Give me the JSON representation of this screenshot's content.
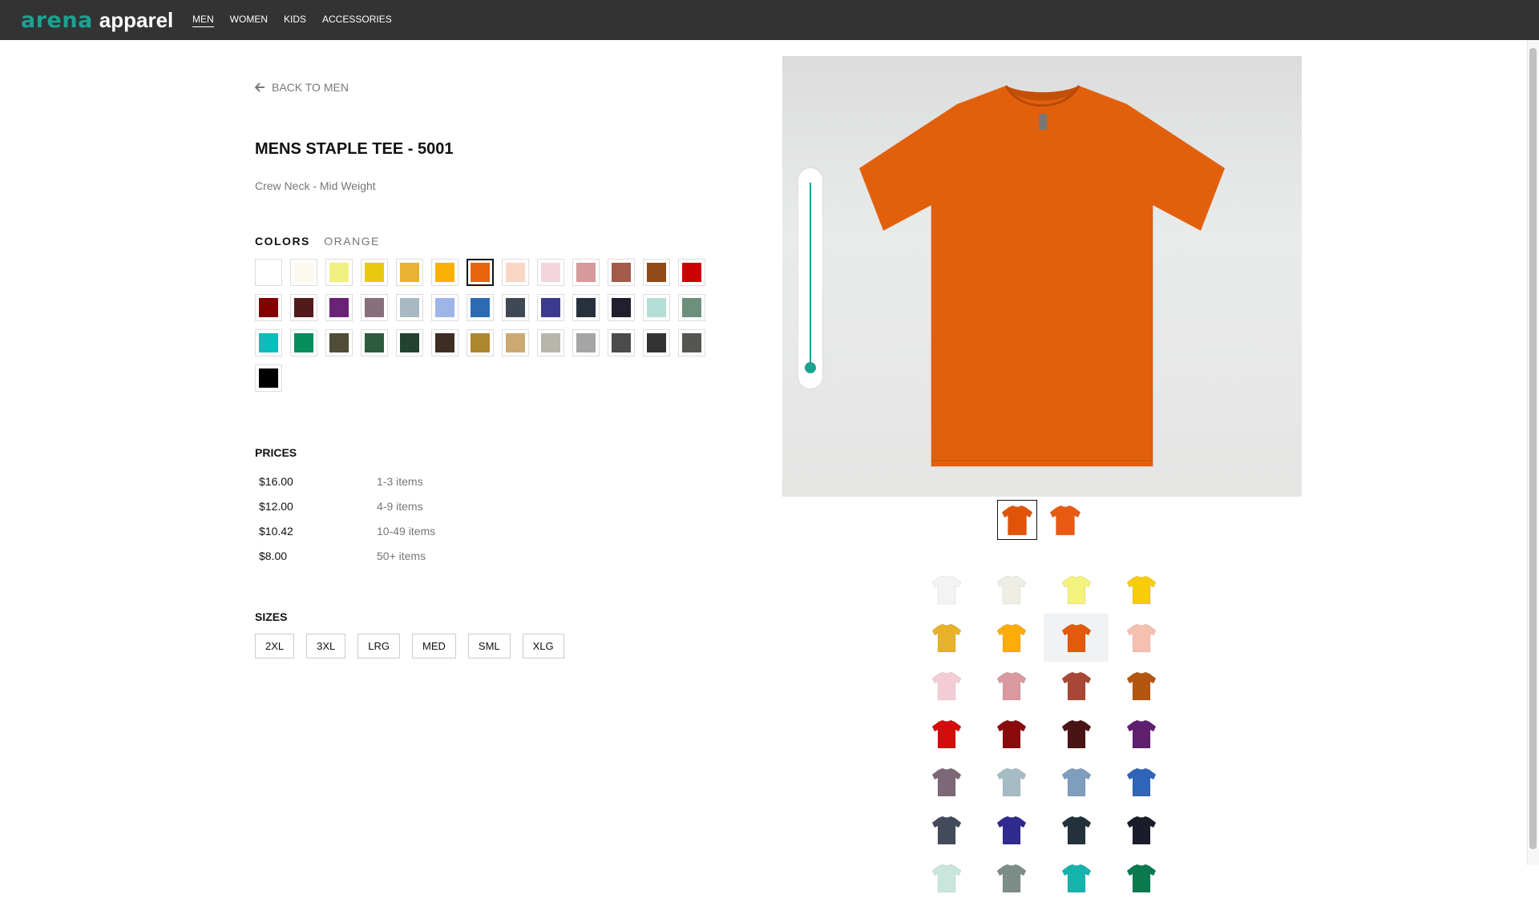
{
  "brand": {
    "logo_arena": "arena",
    "logo_apparel": "apparel"
  },
  "nav": {
    "items": [
      "MEN",
      "WOMEN",
      "KIDS",
      "ACCESSORIES"
    ],
    "active": "MEN"
  },
  "back_link": {
    "label": "BACK TO MEN"
  },
  "product": {
    "title": "MENS STAPLE TEE - 5001",
    "subtitle": "Crew Neck - Mid Weight",
    "main_color": "#e2600c"
  },
  "colors": {
    "label": "COLORS",
    "selected_name": "ORANGE",
    "swatches": [
      "#ffffff",
      "#fbf8ee",
      "#f2f07e",
      "#e8c90e",
      "#e8b330",
      "#fbb103",
      "#e8640c",
      "#f9d6c4",
      "#f3d5db",
      "#d59a99",
      "#a35a4b",
      "#924a19",
      "#cc0202",
      "#840000",
      "#521b1a",
      "#6b2378",
      "#87707b",
      "#a9b9c1",
      "#9db5e7",
      "#2c6bb3",
      "#414855",
      "#3b3a90",
      "#26313b",
      "#211e2e",
      "#b5dfd6",
      "#6d907c",
      "#0abcbc",
      "#068d5b",
      "#4f4d35",
      "#2d5b3d",
      "#234231",
      "#3f2c22",
      "#ae8630",
      "#cca872",
      "#b8b6ab",
      "#a5a5a5",
      "#4b4b4b",
      "#333333",
      "#555652",
      "#000000"
    ],
    "selected_index": 6
  },
  "prices": {
    "label": "PRICES",
    "rows": [
      {
        "price": "$16.00",
        "qty": "1-3 items"
      },
      {
        "price": "$12.00",
        "qty": "4-9 items"
      },
      {
        "price": "$10.42",
        "qty": "10-49 items"
      },
      {
        "price": "$8.00",
        "qty": "50+ items"
      }
    ]
  },
  "sizes": {
    "label": "SIZES",
    "items": [
      "2XL",
      "3XL",
      "LRG",
      "MED",
      "SML",
      "XLG"
    ]
  },
  "zoom_level": 0,
  "thumbnails": {
    "colors": [
      "#e0540a",
      "#e85a12"
    ],
    "active": 0
  },
  "color_grid": {
    "colors": [
      "#f3f3f3",
      "#efeee4",
      "#f2f27c",
      "#f7cc0c",
      "#e7b22a",
      "#fdac0a",
      "#e25a0c",
      "#f6c0b0",
      "#f3cdd6",
      "#d9999e",
      "#a84736",
      "#b45612",
      "#d60c0c",
      "#8b0a0e",
      "#4a1415",
      "#5f1f6e",
      "#7d6878",
      "#a5bcc5",
      "#7f9dbd",
      "#2f64b8",
      "#434a5b",
      "#2e2a8e",
      "#23313b",
      "#1b1c2a",
      "#c8e6dc",
      "#7c8c86",
      "#16b3ad",
      "#0a7a4e"
    ],
    "active": 6
  }
}
